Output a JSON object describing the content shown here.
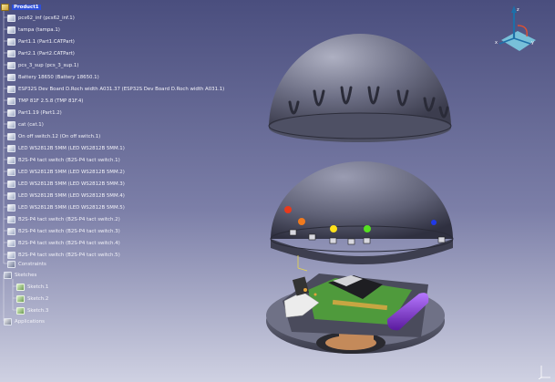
{
  "tree": {
    "root": "Product1",
    "items": [
      "pcs62_inf (pcs62_inf.1)",
      "tampa (tampa.1)",
      "Part1.1 (Part1.CATPart)",
      "Part2.1 (Part2.CATPart)",
      "pcs_3_sup (pcs_3_sup.1)",
      "Battery 18650 (Battery 18650.1)",
      "ESP32S Dev Board D.Roch width A031.37 (ESP32S Dev Board D.Roch width A031.1)",
      "TMP 81F 2.5.8 (TMP 81F.4)",
      "Part1.19 (Part1.2)",
      "cat (cat.1)",
      "On off switch.12 (On off switch.1)",
      "LED WS2812B 5MM (LED WS2812B 5MM.1)",
      "B2S-P4 tact switch (B2S-P4 tact switch.1)",
      "LED WS2812B 5MM (LED WS2812B 5MM.2)",
      "LED WS2812B 5MM (LED WS2812B 5MM.3)",
      "LED WS2812B 5MM (LED WS2812B 5MM.4)",
      "LED WS2812B 5MM (LED WS2812B 5MM.5)",
      "B2S-P4 tact switch (B2S-P4 tact switch.2)",
      "B2S-P4 tact switch (B2S-P4 tact switch.3)",
      "B2S-P4 tact switch (B2S-P4 tact switch.4)",
      "B2S-P4 tact switch (B2S-P4 tact switch.5)"
    ],
    "constraints": "Constraints",
    "sketches_group": "Sketches",
    "sketches": [
      "Sketch.1",
      "Sketch.2",
      "Sketch.3"
    ],
    "applications": "Applications"
  },
  "compass": {
    "axis_x": "x",
    "axis_y": "y",
    "axis_z": "z"
  },
  "icons": {
    "product": "product-icon",
    "part": "part-icon",
    "constraints": "constraints-icon",
    "sketch": "sketch-icon",
    "applications": "applications-icon"
  },
  "colors": {
    "background_top": "#4a4e7e",
    "background_bottom": "#cfd1e2",
    "model_gray": "#5f6175",
    "selection": "#2e4fd8",
    "pcb_green": "#4f9a3c",
    "battery_purple": "#7a30c8"
  }
}
